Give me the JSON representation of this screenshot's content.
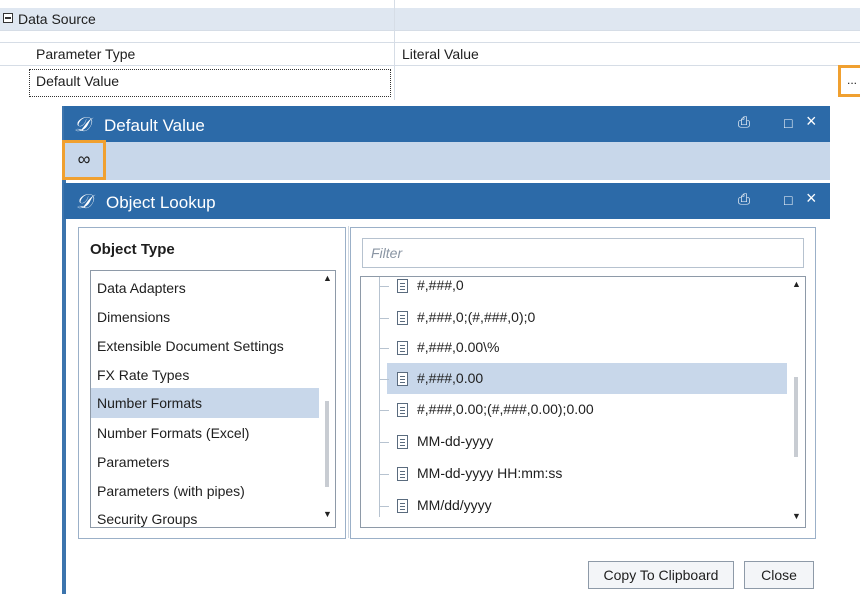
{
  "property_grid": {
    "category": "Data Source",
    "rows": [
      {
        "name": "Parameter Type",
        "value": "Literal Value"
      },
      {
        "name": "Default Value",
        "value": ""
      }
    ],
    "ellipsis_label": "..."
  },
  "default_value_window": {
    "title": "Default Value",
    "logo": "𝒟",
    "toolbar_icon": "glasses-icon"
  },
  "object_lookup_window": {
    "title": "Object Lookup",
    "logo": "𝒟",
    "object_type_heading": "Object Type",
    "object_types": [
      "Data Adapters",
      "Dimensions",
      "Extensible Document Settings",
      "FX Rate Types",
      "Number Formats",
      "Number Formats (Excel)",
      "Parameters",
      "Parameters (with pipes)",
      "Security Groups"
    ],
    "selected_object_type": "Number Formats",
    "filter_placeholder": "Filter",
    "items": [
      "#,###,0",
      "#,###,0;(#,###,0);0",
      "#,###,0.00\\%",
      "#,###,0.00",
      "#,###,0.00;(#,###,0.00);0.00",
      "MM-dd-yyyy",
      "MM-dd-yyyy HH:mm:ss",
      "MM/dd/yyyy"
    ],
    "selected_item": "#,###,0.00",
    "buttons": {
      "copy": "Copy To Clipboard",
      "close": "Close"
    }
  },
  "window_controls": {
    "restore": "⬚",
    "maximize": "□",
    "close": "×"
  }
}
